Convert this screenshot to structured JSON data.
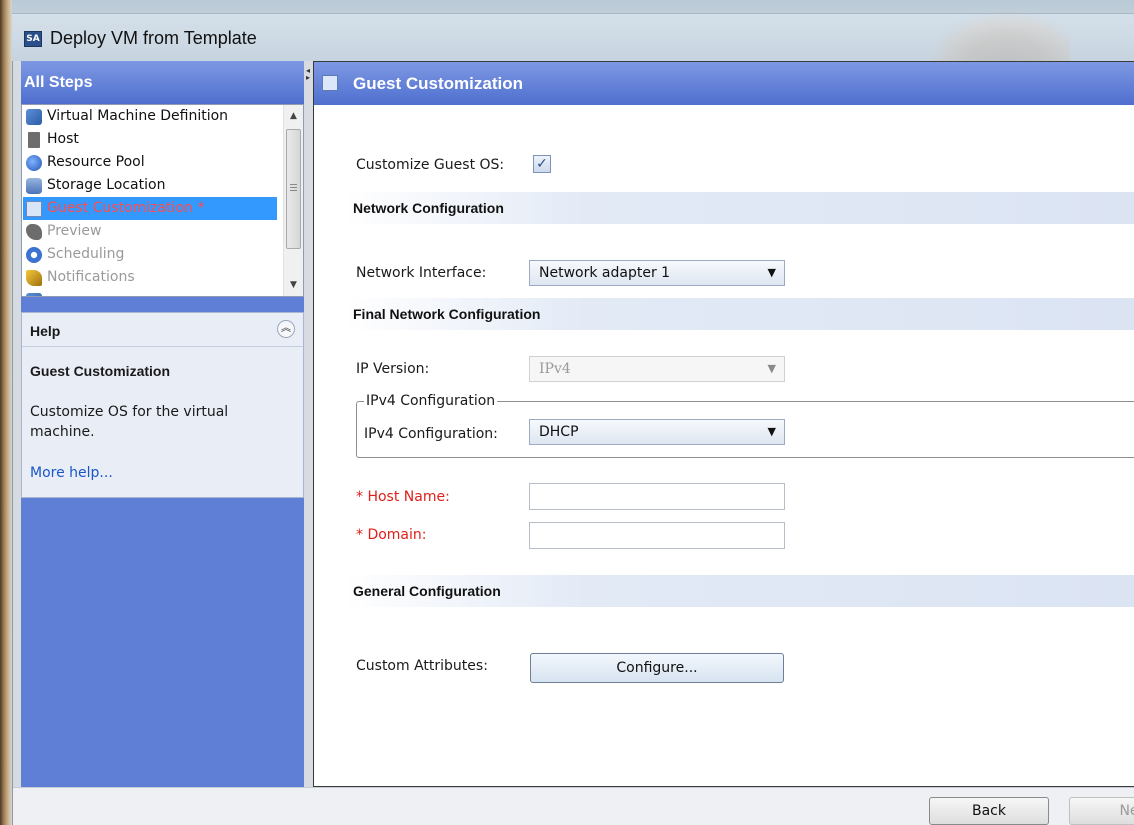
{
  "window": {
    "title": "Deploy VM from Template",
    "app_icon_text": "SA"
  },
  "steps": {
    "header": "All Steps",
    "items": [
      {
        "label": "Virtual Machine Definition",
        "icon": "vm-icon",
        "state": "normal"
      },
      {
        "label": "Host",
        "icon": "host-icon",
        "state": "normal"
      },
      {
        "label": "Resource Pool",
        "icon": "resource-pool-icon",
        "state": "normal"
      },
      {
        "label": "Storage Location",
        "icon": "storage-icon",
        "state": "normal"
      },
      {
        "label": "Guest Customization *",
        "icon": "guest-customization-icon",
        "state": "active"
      },
      {
        "label": "Preview",
        "icon": "preview-icon",
        "state": "disabled"
      },
      {
        "label": "Scheduling",
        "icon": "clock-icon",
        "state": "disabled"
      },
      {
        "label": "Notifications",
        "icon": "notification-icon",
        "state": "disabled"
      }
    ]
  },
  "help": {
    "title": "Help",
    "subtitle": "Guest Customization",
    "body": "Customize OS for the virtual machine.",
    "link": "More help..."
  },
  "pane": {
    "title": "Guest Customization",
    "customize_label": "Customize Guest OS:",
    "customize_checked": true,
    "network_section": "Network Configuration",
    "network_interface_label": "Network Interface:",
    "network_interface_value": "Network adapter 1",
    "final_section": "Final Network Configuration",
    "ip_version_label": "IP Version:",
    "ip_version_value": "IPv4",
    "ipv4_group_legend": "IPv4 Configuration",
    "ipv4_config_label": "IPv4 Configuration:",
    "ipv4_config_value": "DHCP",
    "host_name_label": "* Host Name:",
    "host_name_value": "",
    "domain_label": "* Domain:",
    "domain_value": "",
    "general_section": "General Configuration",
    "custom_attributes_label": "Custom Attributes:",
    "configure_button": "Configure..."
  },
  "footer": {
    "back": "Back",
    "next": "Ne"
  },
  "colors": {
    "accent": "#5f7fd6",
    "required": "#e0201b",
    "selection": "#3399ff",
    "link": "#1a56c7"
  }
}
